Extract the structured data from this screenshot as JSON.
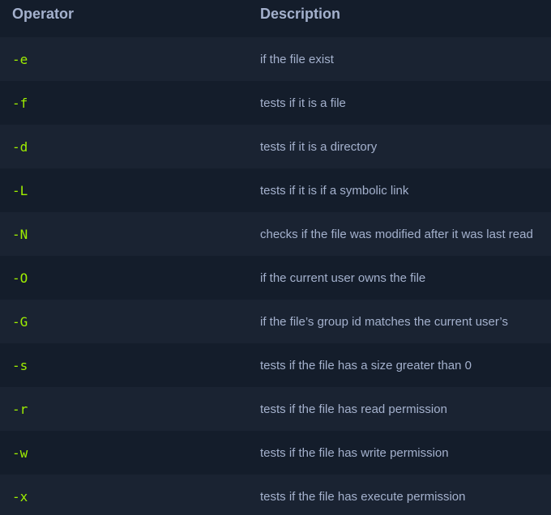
{
  "header": {
    "operator": "Operator",
    "description": "Description"
  },
  "rows": [
    {
      "operator": "-e",
      "description": "if the file exist"
    },
    {
      "operator": "-f",
      "description": "tests if it is a file"
    },
    {
      "operator": "-d",
      "description": "tests if it is a directory"
    },
    {
      "operator": "-L",
      "description": "tests if it is if a symbolic link"
    },
    {
      "operator": "-N",
      "description": "checks if the file was modified after it was last read"
    },
    {
      "operator": "-O",
      "description": "if the current user owns the file"
    },
    {
      "operator": "-G",
      "description": "if the file’s group id matches the current user’s"
    },
    {
      "operator": "-s",
      "description": "tests if the file has a size greater than 0"
    },
    {
      "operator": "-r",
      "description": "tests if the file has read permission"
    },
    {
      "operator": "-w",
      "description": "tests if the file has write permission"
    },
    {
      "operator": "-x",
      "description": "tests if the file has execute permission"
    }
  ],
  "colors": {
    "background": "#141d2b",
    "row_alt": "#1a2332",
    "operator_text": "#9fef00",
    "body_text": "#a4b1cd"
  }
}
